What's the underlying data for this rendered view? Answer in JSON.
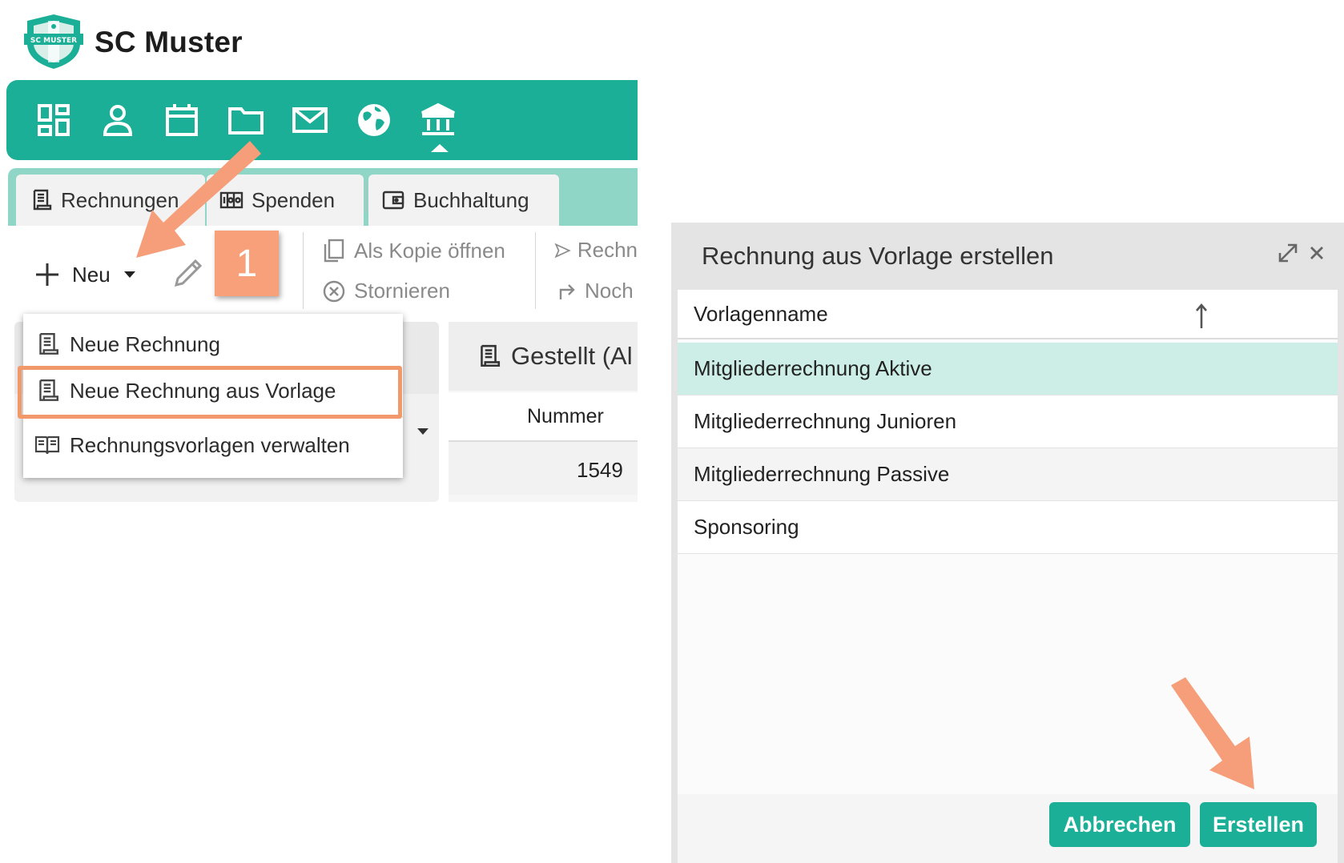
{
  "app": {
    "title": "SC Muster",
    "logo_text": "SC MUSTER"
  },
  "colors": {
    "brand": "#1aaf96",
    "tabstrip": "#8fd6c6",
    "annotation": "#f2996b",
    "selected_row": "#cdeee6"
  },
  "nav": {
    "icons": [
      "dashboard-icon",
      "person-icon",
      "calendar-icon",
      "folder-icon",
      "mail-icon",
      "globe-icon",
      "bank-icon"
    ]
  },
  "tabs": [
    {
      "label": "Rechnungen",
      "icon": "receipt-icon"
    },
    {
      "label": "Spenden",
      "icon": "counter-icon"
    },
    {
      "label": "Buchhaltung",
      "icon": "wallet-icon"
    }
  ],
  "toolbar": {
    "new_label": "Neu",
    "copy_label": "Als Kopie öffnen",
    "cancel_label": "Stornieren",
    "send_label": "Rechn",
    "again_label": "Noch"
  },
  "annotation": {
    "step": "1"
  },
  "dropdown": {
    "items": [
      {
        "label": "Neue Rechnung",
        "icon": "receipt-icon"
      },
      {
        "label": "Neue Rechnung aus Vorlage",
        "icon": "receipt-icon"
      },
      {
        "label": "Rechnungsvorlagen verwalten",
        "icon": "book-icon"
      }
    ]
  },
  "list": {
    "header": "Gestellt (Al",
    "column": "Nummer",
    "rows": [
      "1549"
    ]
  },
  "dialog": {
    "title": "Rechnung aus Vorlage erstellen",
    "column": "Vorlagenname",
    "rows": [
      "Mitgliederrechnung Aktive",
      "Mitgliederrechnung Junioren",
      "Mitgliederrechnung Passive",
      "Sponsoring"
    ],
    "cancel_label": "Abbrechen",
    "create_label": "Erstellen"
  }
}
